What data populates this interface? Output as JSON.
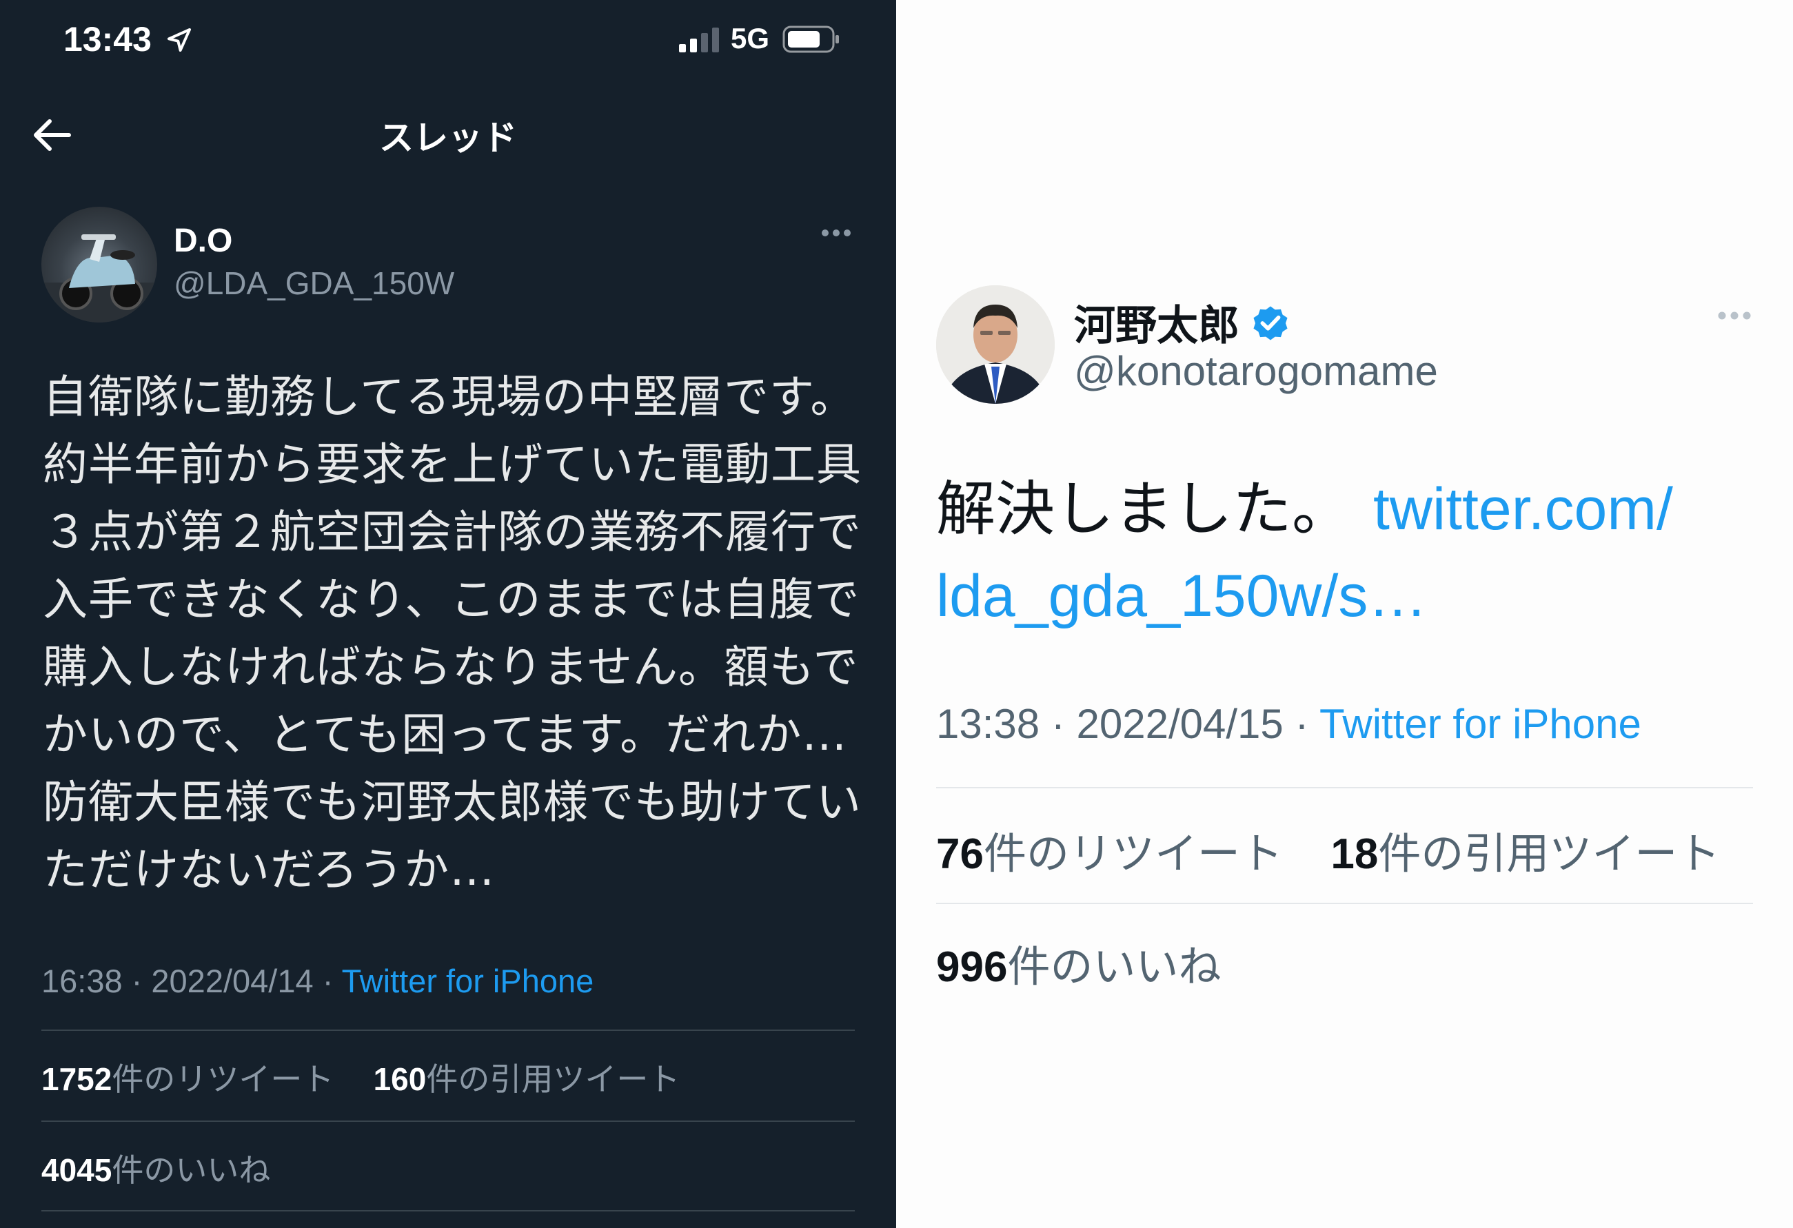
{
  "left_tweet": {
    "status_bar": {
      "time": "13:43",
      "network": "5G",
      "icons": [
        "location-arrow-icon",
        "signal-icon",
        "battery-icon"
      ]
    },
    "header": {
      "title": "スレッド",
      "back_icon": "arrow-left-icon"
    },
    "author": {
      "name": "D.O",
      "handle": "@LDA_GDA_150W",
      "avatar": "motor-scooter-photo"
    },
    "body_lines": [
      "自衛隊に勤務してる現場の中堅層です。",
      "約半年前から要求を上げていた電動工具",
      "３点が第２航空団会計隊の業務不履行で",
      "入手できなくなり、このままでは自腹で",
      "購入しなければならなりません。額もで",
      "かいので、とても困ってます。だれか…",
      "防衛大臣様でも河野太郎様でも助けてい",
      "ただけないだろうか…"
    ],
    "meta": {
      "time": "16:38",
      "sep1": " · ",
      "date": "2022/04/14",
      "sep2": " · ",
      "source": "Twitter for iPhone"
    },
    "stats": {
      "retweets": "1752",
      "retweets_label": "件のリツイート",
      "quotes": "160",
      "quotes_label": "件の引用ツイート",
      "likes": "4045",
      "likes_label": "件のいいね"
    },
    "colors": {
      "background": "#15202b",
      "link": "#1d9bf0",
      "secondary": "#8b98a5",
      "divider": "#38444d"
    }
  },
  "right_tweet": {
    "author": {
      "name": "河野太郎",
      "handle": "@konotarogomame",
      "verified": true,
      "avatar": "man-in-suit-portrait"
    },
    "body_text": "解決しました。",
    "link_line1": "twitter.com/",
    "link_line2": "lda_gda_150w/s…",
    "meta": {
      "time": "13:38",
      "sep1": " · ",
      "date": "2022/04/15",
      "sep2": " · ",
      "source": "Twitter for iPhone"
    },
    "stats": {
      "retweets": "76",
      "retweets_label": "件のリツイート",
      "quotes": "18",
      "quotes_label": "件の引用ツイート",
      "likes": "996",
      "likes_label": "件のいいね"
    },
    "colors": {
      "background": "#fdfdfd",
      "link": "#1d9bf0",
      "verified_badge": "#1d9bf0",
      "divider": "#e4e7ea"
    }
  }
}
